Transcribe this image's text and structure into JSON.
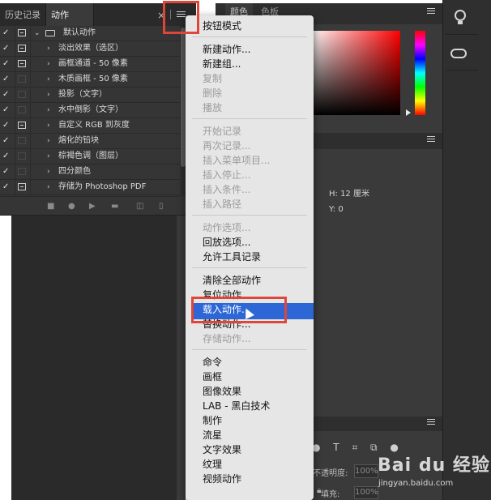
{
  "panel": {
    "tabs": [
      "历史记录",
      "动作"
    ],
    "active_tab": "动作",
    "close_glyph": "×",
    "actions": [
      {
        "check": "✓",
        "dialog": "on",
        "label": "默认动作",
        "type": "set",
        "expanded": true
      },
      {
        "check": "✓",
        "dialog": "on",
        "label": "淡出效果（选区）"
      },
      {
        "check": "✓",
        "dialog": "on",
        "label": "画框通道 - 50 像素"
      },
      {
        "check": "✓",
        "dialog": "off",
        "label": "木质画框 - 50 像素"
      },
      {
        "check": "✓",
        "dialog": "off",
        "label": "投影（文字）"
      },
      {
        "check": "✓",
        "dialog": "off",
        "label": "水中倒影（文字）"
      },
      {
        "check": "✓",
        "dialog": "on",
        "label": "自定义 RGB 到灰度"
      },
      {
        "check": "✓",
        "dialog": "off",
        "label": "熔化的铅块"
      },
      {
        "check": "✓",
        "dialog": "off",
        "label": "棕褐色调（图层）"
      },
      {
        "check": "✓",
        "dialog": "off",
        "label": "四分颜色"
      },
      {
        "check": "✓",
        "dialog": "on",
        "label": "存储为 Photoshop PDF"
      }
    ],
    "bottom_icons": [
      "stop-icon",
      "record-icon",
      "play-icon",
      "new-set-folder-icon",
      "new-action-icon",
      "trash-icon"
    ]
  },
  "color_panel": {
    "tabs": [
      "颜色",
      "色板"
    ]
  },
  "info_panel": {
    "h_readout": "H: 12 厘米",
    "y_readout": "Y: 0"
  },
  "layers_panel": {
    "opacity_label": "不透明度:",
    "opacity_value": "100%",
    "fill_label": "填充:",
    "fill_value": "100%"
  },
  "dropdown_menu": {
    "groups": [
      [
        {
          "label": "按钮模式",
          "enabled": true
        }
      ],
      [
        {
          "label": "新建动作...",
          "enabled": true
        },
        {
          "label": "新建组...",
          "enabled": true
        },
        {
          "label": "复制",
          "enabled": false
        },
        {
          "label": "删除",
          "enabled": false
        },
        {
          "label": "播放",
          "enabled": false
        }
      ],
      [
        {
          "label": "开始记录",
          "enabled": false
        },
        {
          "label": "再次记录...",
          "enabled": false
        },
        {
          "label": "插入菜单项目...",
          "enabled": false
        },
        {
          "label": "插入停止...",
          "enabled": false
        },
        {
          "label": "插入条件...",
          "enabled": false
        },
        {
          "label": "插入路径",
          "enabled": false
        }
      ],
      [
        {
          "label": "动作选项...",
          "enabled": false
        },
        {
          "label": "回放选项...",
          "enabled": true
        },
        {
          "label": "允许工具记录",
          "enabled": true
        }
      ],
      [
        {
          "label": "清除全部动作",
          "enabled": true
        },
        {
          "label": "复位动作",
          "enabled": true
        },
        {
          "label": "载入动作...",
          "enabled": true,
          "highlighted": true
        },
        {
          "label": "替换动作...",
          "enabled": true
        },
        {
          "label": "存储动作...",
          "enabled": false
        }
      ],
      [
        {
          "label": "命令",
          "enabled": true
        },
        {
          "label": "画框",
          "enabled": true
        },
        {
          "label": "图像效果",
          "enabled": true
        },
        {
          "label": "LAB - 黑白技术",
          "enabled": true
        },
        {
          "label": "制作",
          "enabled": true
        },
        {
          "label": "流星",
          "enabled": true
        },
        {
          "label": "文字效果",
          "enabled": true
        },
        {
          "label": "纹理",
          "enabled": true
        },
        {
          "label": "视频动作",
          "enabled": true
        }
      ]
    ]
  },
  "watermark": {
    "brand": "Bai du 经验",
    "url": "jingyan.baidu.com"
  },
  "colors": {
    "highlight": "#2d67d6",
    "annotation_red": "#e0453a",
    "panel_bg": "#353535",
    "menu_bg": "#e6e6e6"
  }
}
